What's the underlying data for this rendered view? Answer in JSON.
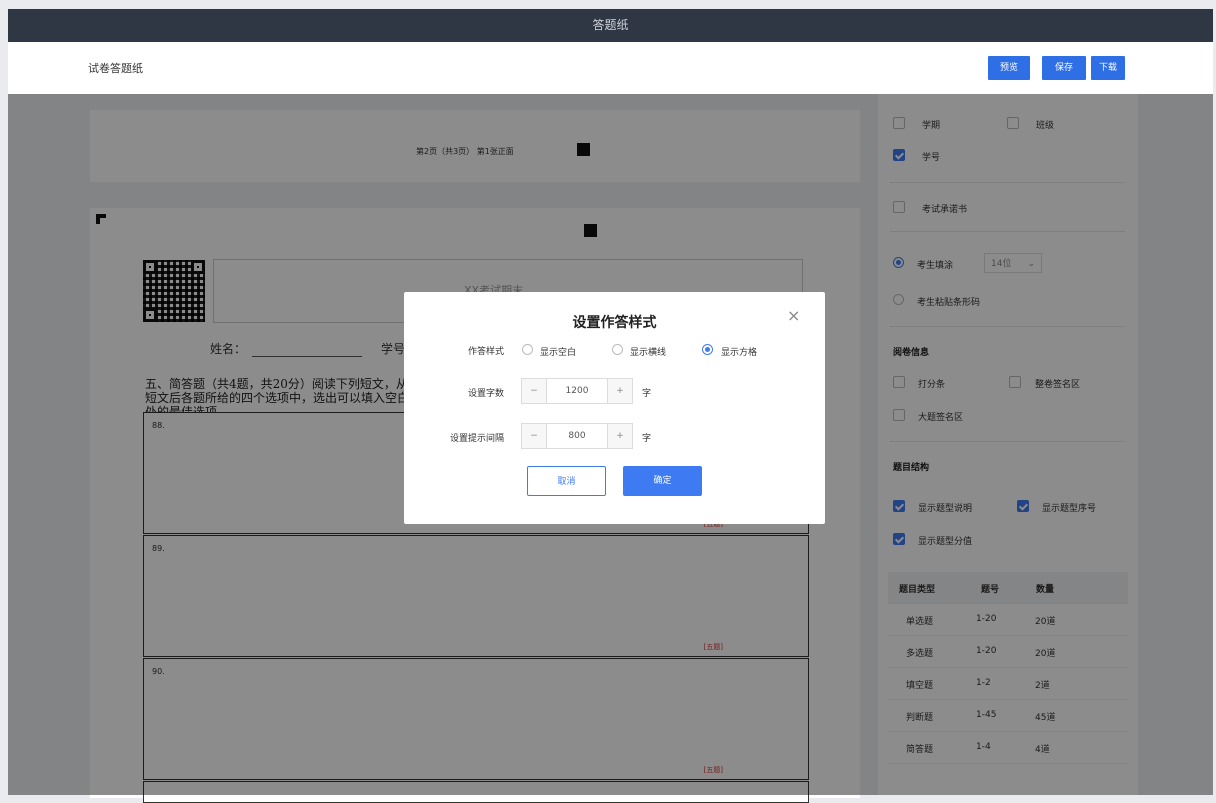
{
  "app": {
    "top_title": "答题纸",
    "page_title": "试卷答题纸"
  },
  "toolbar": {
    "preview": "预览",
    "save": "保存",
    "download": "下载"
  },
  "sheet": {
    "page_info": "第2页（共3页） 第1张正面",
    "exam_placeholder": "XX考试期末",
    "name_label": "姓名：",
    "student_no_label": "学号",
    "section_text": "五、简答题（共4题，共20分）阅读下列短文，从短文后各题所给的四个选项中，选出可以填入空白处的最佳选项。",
    "questions": [
      {
        "num": "88.",
        "score": "[五题]"
      },
      {
        "num": "89.",
        "score": "[五题]"
      },
      {
        "num": "90.",
        "score": "[五题]"
      }
    ]
  },
  "sidebar": {
    "opt_term": "学期",
    "opt_class": "班级",
    "opt_student_no": "学号",
    "opt_pledge": "考试承诺书",
    "radio_fill": "考生填涂",
    "fill_digits": "14位",
    "radio_barcode": "考生粘贴条形码",
    "section_review": "阅卷信息",
    "opt_score_bar": "打分条",
    "opt_whole_sign": "整卷签名区",
    "opt_big_sign": "大题签名区",
    "section_structure": "题目结构",
    "opt_show_desc": "显示题型说明",
    "opt_show_seq": "显示题型序号",
    "opt_show_score": "显示题型分值",
    "table": {
      "headers": [
        "题目类型",
        "题号",
        "数量"
      ],
      "rows": [
        [
          "单选题",
          "1-20",
          "20道"
        ],
        [
          "多选题",
          "1-20",
          "20道"
        ],
        [
          "填空题",
          "1-2",
          "2道"
        ],
        [
          "判断题",
          "1-45",
          "45道"
        ],
        [
          "简答题",
          "1-4",
          "4道"
        ]
      ]
    }
  },
  "modal": {
    "title": "设置作答样式",
    "style_label": "作答样式",
    "opt_blank": "显示空白",
    "opt_lines": "显示横线",
    "opt_grid": "显示方格",
    "word_count_label": "设置字数",
    "word_count_value": "1200",
    "interval_label": "设置提示间隔",
    "interval_value": "800",
    "unit": "字",
    "cancel": "取消",
    "confirm": "确定",
    "minus": "−",
    "plus": "+",
    "close": "×"
  }
}
